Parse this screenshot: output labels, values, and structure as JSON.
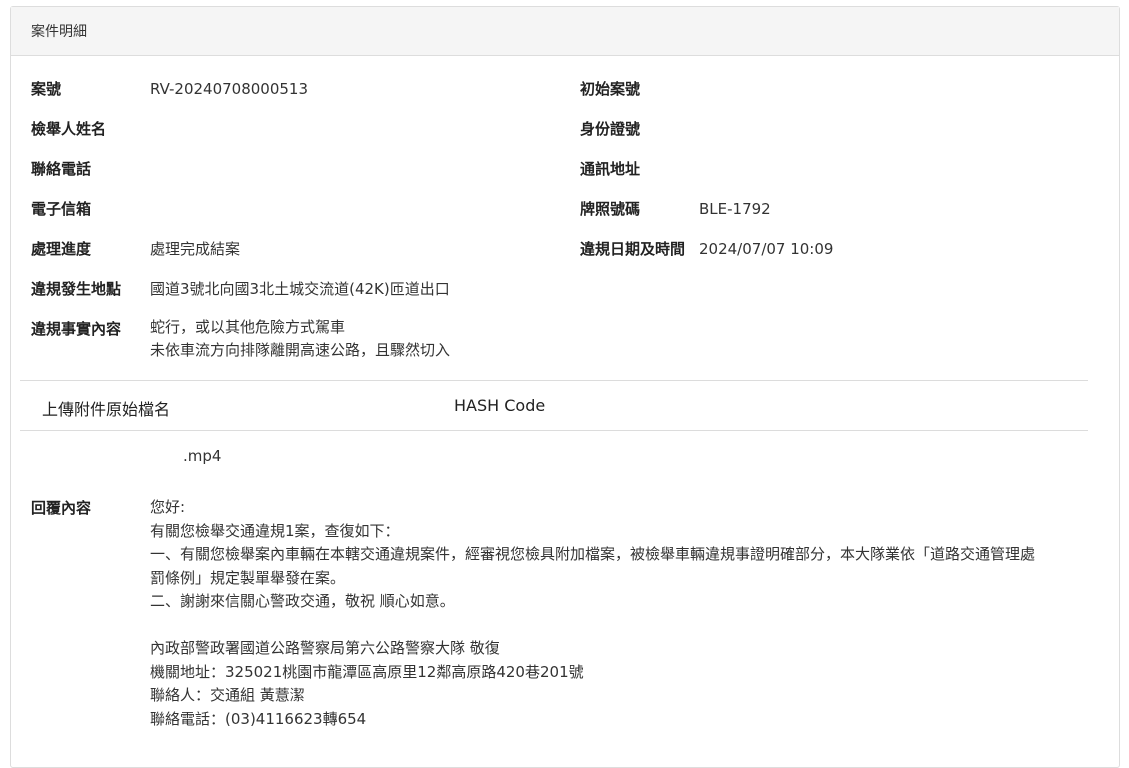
{
  "panel": {
    "title": "案件明細"
  },
  "fields": {
    "case_no_label": "案號",
    "case_no_value": "RV-20240708000513",
    "original_case_no_label": "初始案號",
    "original_case_no_value": "",
    "reporter_name_label": "檢舉人姓名",
    "reporter_name_value": "",
    "id_no_label": "身份證號",
    "id_no_value": "",
    "phone_label": "聯絡電話",
    "phone_value": "",
    "address_label": "通訊地址",
    "address_value": "",
    "email_label": "電子信箱",
    "email_value": "",
    "plate_label": "牌照號碼",
    "plate_value": "BLE-1792",
    "progress_label": "處理進度",
    "progress_value": "處理完成結案",
    "violation_datetime_label": "違規日期及時間",
    "violation_datetime_value": "2024/07/07 10:09",
    "location_label": "違規發生地點",
    "location_value": "國道3號北向國3北土城交流道(42K)匝道出口",
    "facts_label": "違規事實內容",
    "facts_lines": [
      "蛇行，或以其他危險方式駕車",
      "未依車流方向排隊離開高速公路，且驟然切入"
    ]
  },
  "attachments": {
    "col_filename": "上傳附件原始檔名",
    "col_hash": "HASH Code",
    "rows": [
      {
        "filename": ".mp4",
        "hash": ""
      }
    ]
  },
  "reply": {
    "label": "回覆內容",
    "lines": [
      "您好:",
      "有關您檢舉交通違規1案，查復如下：",
      "一、有關您檢舉案內車輛在本轄交通違規案件，經審視您檢具附加檔案，被檢舉車輛違規事證明確部分，本大隊業依「道路交通管理處",
      "罰條例」規定製單舉發在案。",
      "二、謝謝來信關心警政交通，敬祝 順心如意。",
      "",
      "內政部警政署國道公路警察局第六公路警察大隊 敬復",
      "機關地址：325021桃園市龍潭區高原里12鄰高原路420巷201號",
      "聯絡人：交通組 黃薏潔",
      "聯絡電話：(03)4116623轉654"
    ]
  }
}
